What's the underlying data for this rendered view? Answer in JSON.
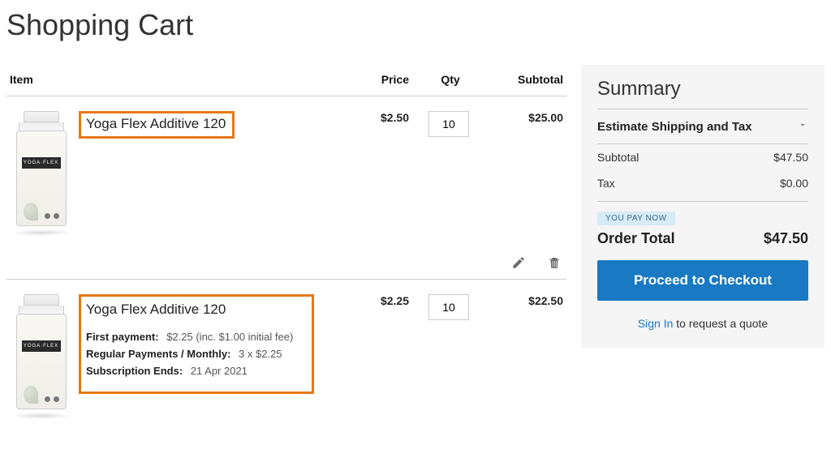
{
  "page": {
    "title": "Shopping Cart"
  },
  "columns": {
    "item": "Item",
    "price": "Price",
    "qty": "Qty",
    "subtotal": "Subtotal"
  },
  "items": [
    {
      "name": "Yoga Flex Additive 120",
      "price": "$2.50",
      "qty": "10",
      "subtotal": "$25.00",
      "bottle_label": "YOGA·FLEX"
    },
    {
      "name": "Yoga Flex Additive 120",
      "price": "$2.25",
      "qty": "10",
      "subtotal": "$22.50",
      "bottle_label": "YOGA·FLEX",
      "subscription": {
        "first_payment_label": "First payment:",
        "first_payment_value": "$2.25 (inc. $1.00 initial fee)",
        "regular_label": "Regular Payments / Monthly:",
        "regular_value": "3 x $2.25",
        "ends_label": "Subscription Ends:",
        "ends_value": "21 Apr 2021"
      }
    }
  ],
  "summary": {
    "heading": "Summary",
    "estimate_label": "Estimate Shipping and Tax",
    "subtotal_label": "Subtotal",
    "subtotal_value": "$47.50",
    "tax_label": "Tax",
    "tax_value": "$0.00",
    "pay_now_badge": "YOU PAY NOW",
    "order_total_label": "Order Total",
    "order_total_value": "$47.50",
    "checkout_label": "Proceed to Checkout",
    "signin_link": "Sign In",
    "signin_rest": " to request a quote"
  }
}
